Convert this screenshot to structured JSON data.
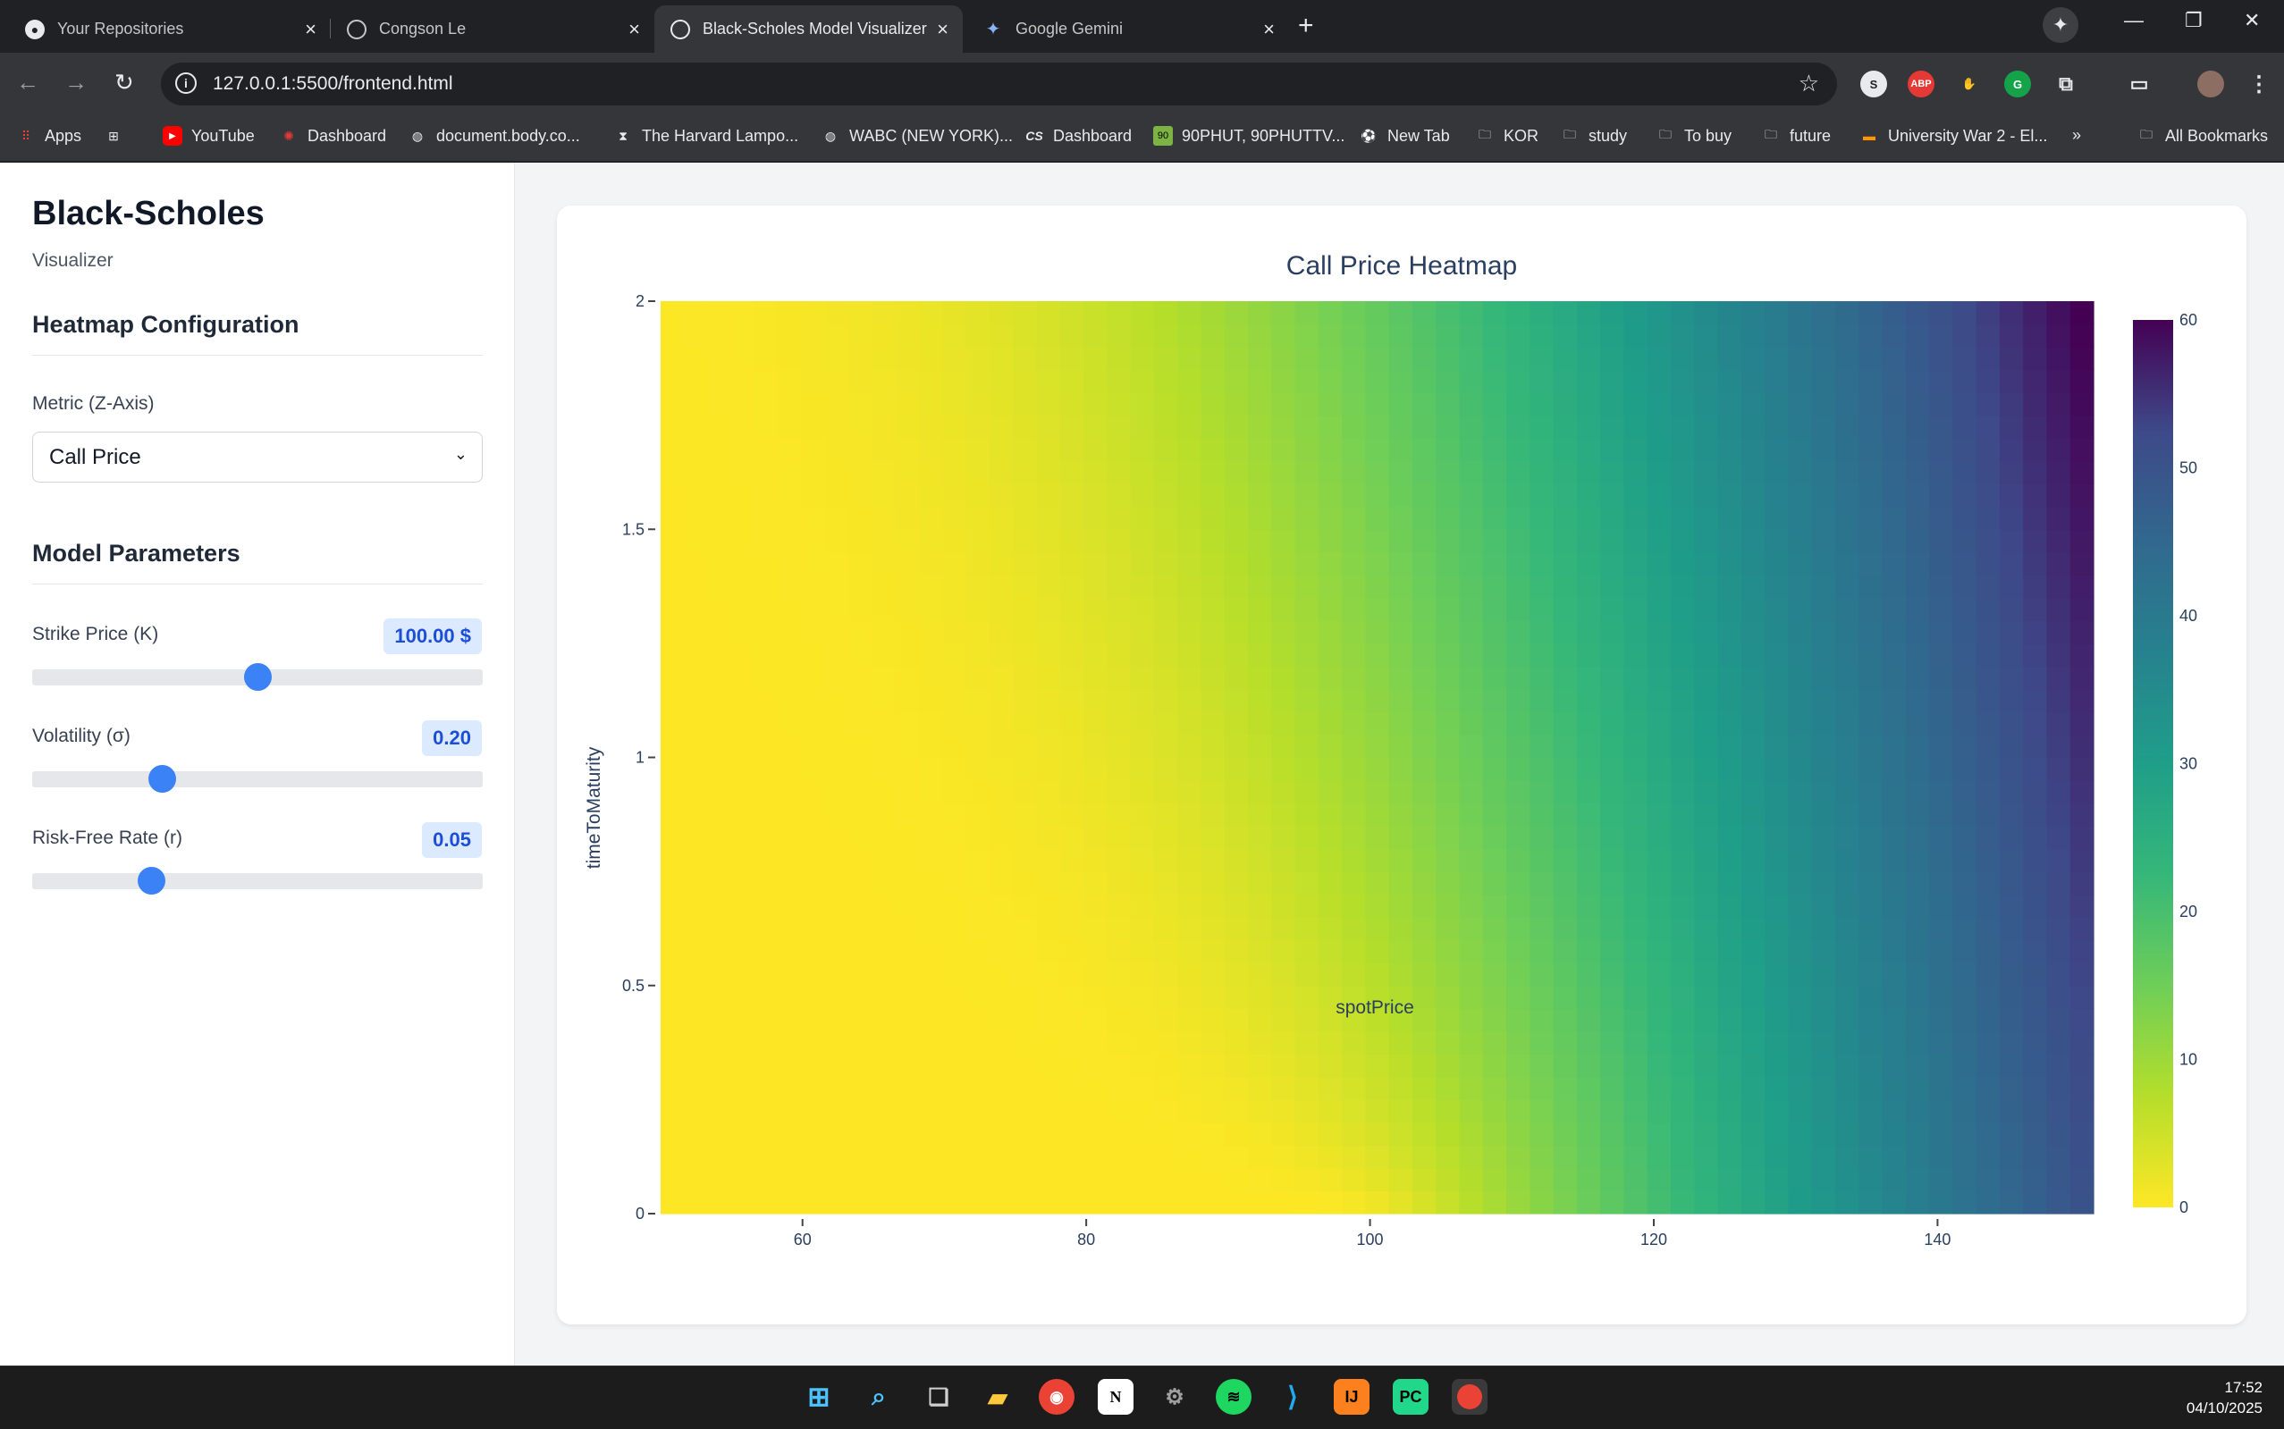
{
  "browser": {
    "tabs": [
      {
        "title": "Your Repositories"
      },
      {
        "title": "Congson Le"
      },
      {
        "title": "Black-Scholes Model Visualizer"
      },
      {
        "title": "Google Gemini"
      }
    ],
    "url": "127.0.0.1:5500/frontend.html",
    "bookmarks": [
      "Apps",
      "YouTube",
      "Dashboard",
      "document.body.co...",
      "The Harvard Lampo...",
      "WABC (NEW YORK)...",
      "Dashboard",
      "90PHUT, 90PHUTTV...",
      "New Tab",
      "KOR",
      "study",
      "To buy",
      "future",
      "University War 2 - El...",
      "All Bookmarks"
    ]
  },
  "sidebar": {
    "title": "Black-Scholes",
    "subtitle": "Visualizer",
    "heatmap_config": {
      "heading": "Heatmap Configuration",
      "metric_label": "Metric (Z-Axis)",
      "metric_value": "Call Price"
    },
    "model_params": {
      "heading": "Model Parameters",
      "strike": {
        "label": "Strike Price (K)",
        "display": "100.00 $",
        "value": 100,
        "min": 50,
        "max": 150
      },
      "volatility": {
        "label": "Volatility (σ)",
        "display": "0.20",
        "value": 0.2,
        "min": 0.01,
        "max": 0.7
      },
      "rate": {
        "label": "Risk-Free Rate (r)",
        "display": "0.05",
        "value": 0.05,
        "min": 0,
        "max": 0.2
      }
    }
  },
  "chart_data": {
    "type": "heatmap",
    "title": "Call Price Heatmap",
    "xlabel": "spotPrice",
    "ylabel": "timeToMaturity",
    "xlim": [
      50,
      151
    ],
    "ylim": [
      0,
      2
    ],
    "xticks": [
      60,
      80,
      100,
      120,
      140
    ],
    "yticks": [
      0,
      0.5,
      1,
      1.5,
      2
    ],
    "colorscale": "Viridis (reversed)",
    "colorbar": {
      "min": 0,
      "max": 60,
      "ticks": [
        0,
        10,
        20,
        30,
        40,
        50,
        60
      ]
    },
    "params": {
      "strike": 100,
      "volatility": 0.2,
      "rate": 0.05
    },
    "grid": {
      "x_steps": 61,
      "y_steps": 40
    }
  },
  "taskbar": {
    "time": "17:52",
    "date": "04/10/2025"
  }
}
